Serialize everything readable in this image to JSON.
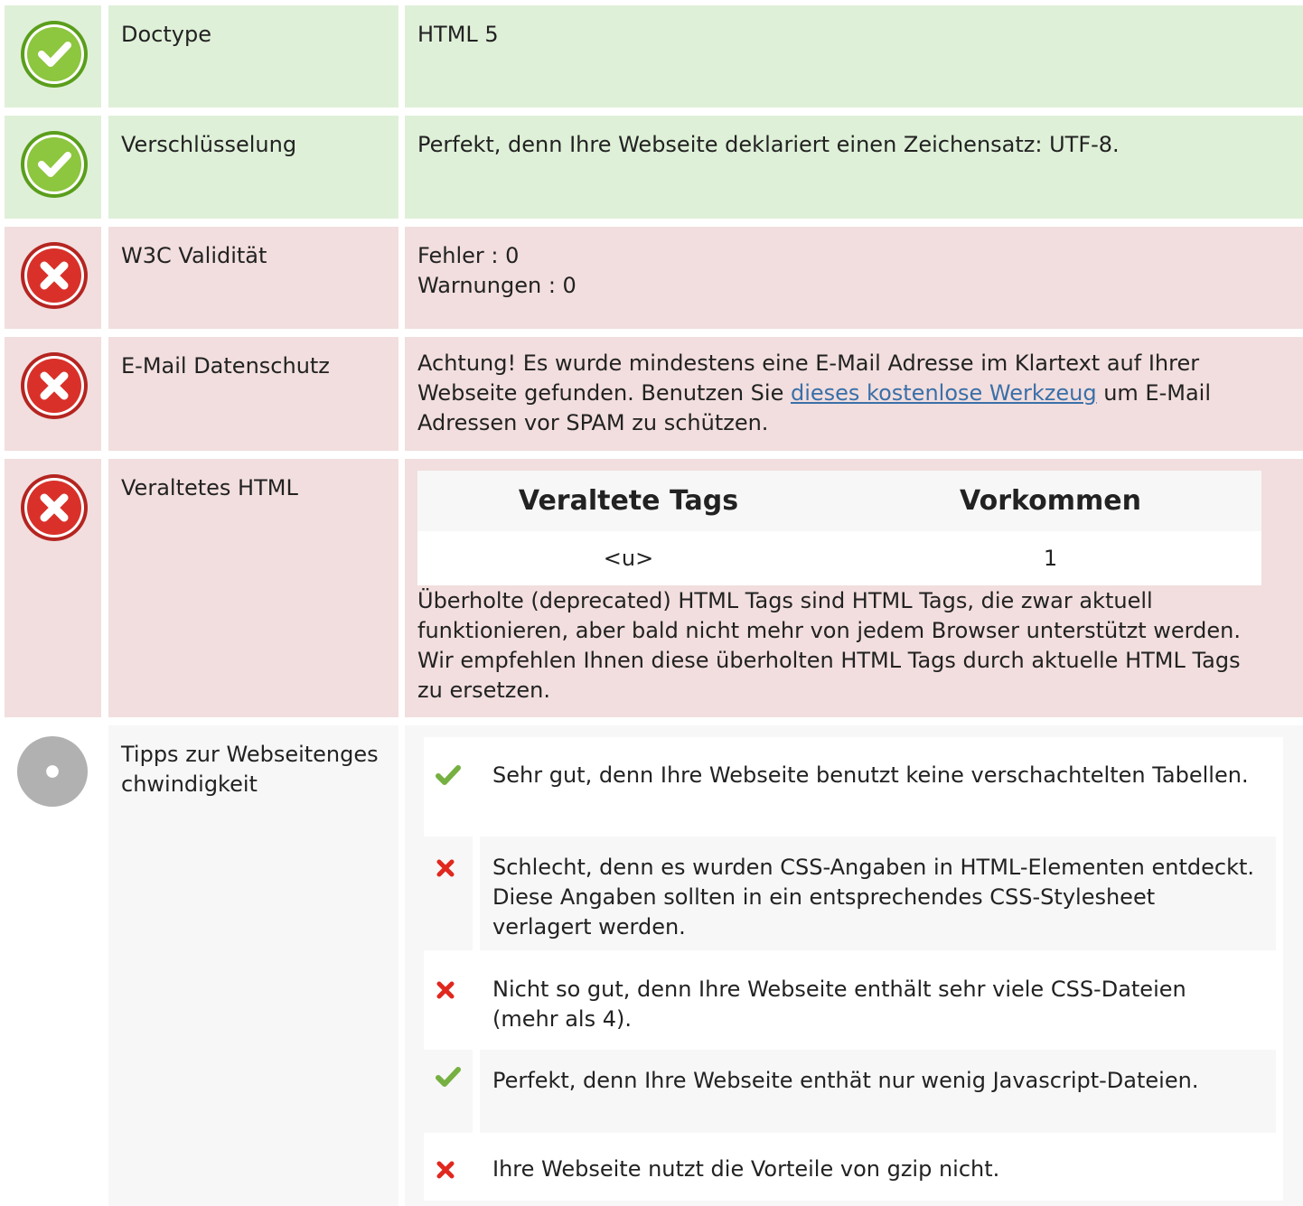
{
  "colors": {
    "ok": "#dff0d8",
    "error": "#f2dede",
    "neutral": "#f7f7f7",
    "check_green": "#8dc63f",
    "error_red": "#d9312a",
    "link": "#3a6fa8"
  },
  "rows": {
    "doctype": {
      "status_icon": "check-circle-icon",
      "label": "Doctype",
      "value": "HTML 5"
    },
    "encoding": {
      "status_icon": "check-circle-icon",
      "label": "Verschlüsselung",
      "value": "Perfekt, denn Ihre Webseite deklariert einen Zeichensatz: UTF-8."
    },
    "w3c": {
      "status_icon": "error-circle-icon",
      "label": "W3C Validität",
      "line1": "Fehler : 0",
      "line2": "Warnungen : 0"
    },
    "email": {
      "status_icon": "error-circle-icon",
      "label": "E-Mail Datenschutz",
      "text_before": "Achtung! Es wurde mindestens eine E-Mail Adresse im Klartext auf Ihrer Webseite gefunden. Benutzen Sie ",
      "link_text": "dieses kostenlose Werkzeug",
      "text_after": " um E-Mail Adressen vor SPAM zu schützen."
    },
    "deprecated": {
      "status_icon": "error-circle-icon",
      "label": "Veraltetes HTML",
      "table": {
        "header_tag": "Veraltete Tags",
        "header_count": "Vorkommen",
        "rows": [
          {
            "tag": "<u>",
            "count": "1"
          }
        ]
      },
      "note": "Überholte (deprecated) HTML Tags sind HTML Tags, die zwar aktuell funktionieren, aber bald nicht mehr von jedem Browser unterstützt werden. Wir empfehlen Ihnen diese überholten HTML Tags durch aktuelle HTML Tags zu ersetzen."
    },
    "tips": {
      "status_icon": "info-circle-icon",
      "label": "Tipps zur Webseitengeschwindigkeit",
      "items": [
        {
          "icon": "check-icon",
          "status": "good",
          "text": "Sehr gut, denn Ihre Webseite benutzt keine verschachtelten Tabellen."
        },
        {
          "icon": "x-icon",
          "status": "bad",
          "text": "Schlecht, denn es wurden CSS-Angaben in HTML-Elementen entdeckt. Diese Angaben sollten in ein entsprechendes CSS-Stylesheet verlagert werden."
        },
        {
          "icon": "x-icon",
          "status": "bad",
          "text": "Nicht so gut, denn Ihre Webseite enthält sehr viele CSS-Dateien (mehr als 4)."
        },
        {
          "icon": "check-icon",
          "status": "good",
          "text": "Perfekt, denn Ihre Webseite enthät nur wenig Javascript-Dateien."
        },
        {
          "icon": "x-icon",
          "status": "bad",
          "text": "Ihre Webseite nutzt die Vorteile von gzip nicht."
        }
      ]
    }
  }
}
